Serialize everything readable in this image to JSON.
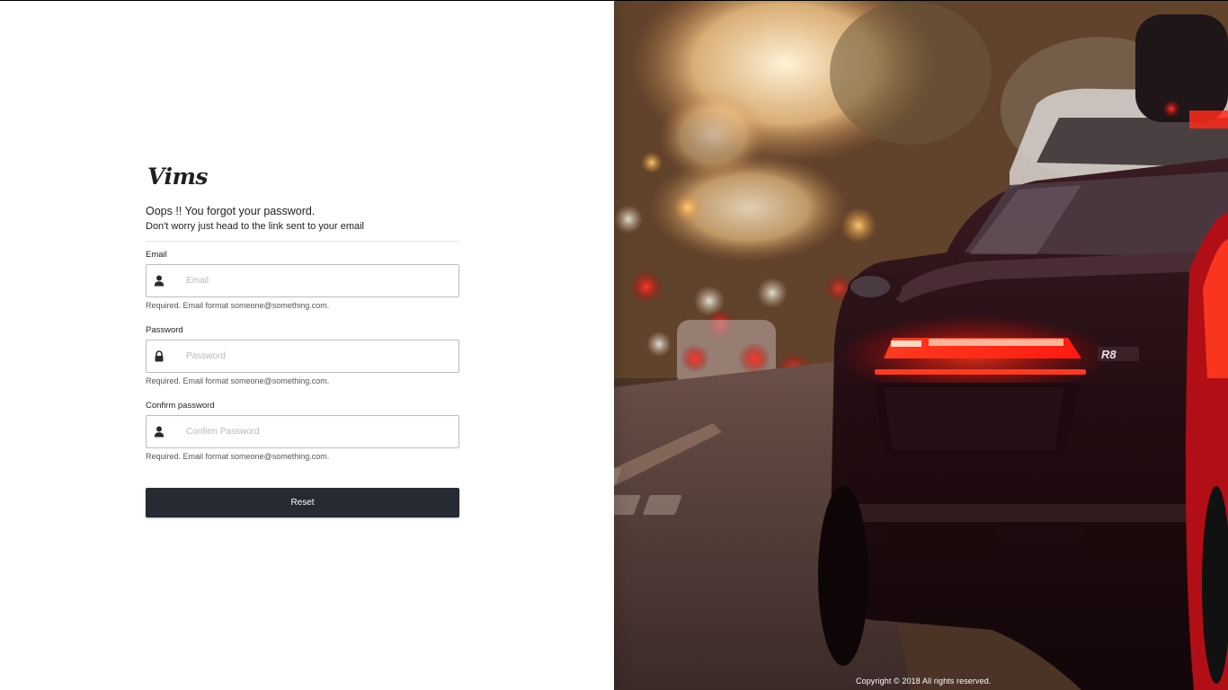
{
  "brand": {
    "logo_text": "Vims"
  },
  "form": {
    "heading": "Oops !! You forgot your password.",
    "subheading": "Don't worry just head to the link sent to your email",
    "fields": [
      {
        "label": "Email",
        "placeholder": "Email",
        "icon": "user-icon",
        "help": "Required. Email format someone@something.com."
      },
      {
        "label": "Password",
        "placeholder": "Password",
        "icon": "lock-icon",
        "help": "Required. Email format someone@something.com."
      },
      {
        "label": "Confirm password",
        "placeholder": "Confirm Password",
        "icon": "user-icon",
        "help": "Required. Email format someone@something.com."
      }
    ],
    "submit_label": "Reset"
  },
  "background": {
    "image": "red-sports-car-rear-view-icon",
    "copyright": "Copyright © 2018 All rights reserved."
  },
  "colors": {
    "button_bg": "#262a33",
    "button_text": "#ffffff",
    "taillight": "#ff2a1a"
  }
}
